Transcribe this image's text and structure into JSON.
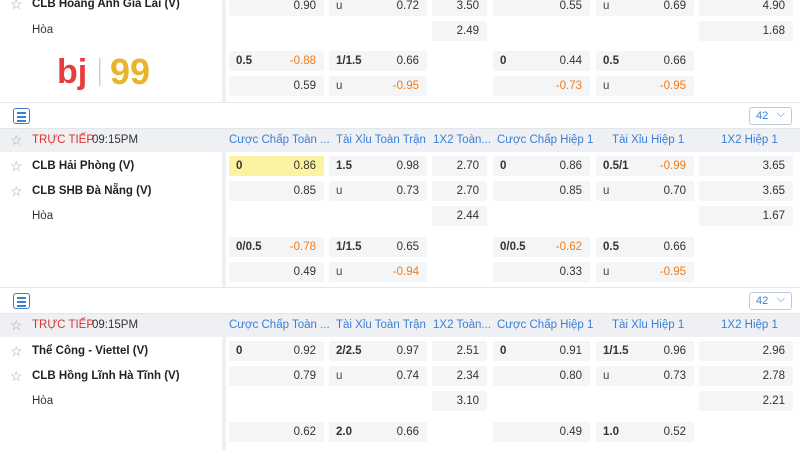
{
  "logo": {
    "part1": "bj",
    "part2": "99"
  },
  "match0": {
    "team1": "CLB Hoàng Anh Gia Lai (V)",
    "draw": "Hòa",
    "row1": [
      [
        "",
        "0.90"
      ],
      [
        "u",
        "0.72"
      ],
      [
        "3.50",
        ""
      ],
      [
        "",
        "0.55"
      ],
      [
        "u",
        "0.69"
      ],
      [
        "4.90",
        ""
      ]
    ],
    "drawrow": [
      "2.49",
      "1.68"
    ],
    "alt1": [
      [
        "0.5",
        "-0.88"
      ],
      [
        "1/1.5",
        "0.66"
      ],
      [
        "0",
        "0.44"
      ],
      [
        "0.5",
        "0.66"
      ]
    ],
    "alt2": [
      [
        "",
        "0.59"
      ],
      [
        "u",
        "-0.95"
      ],
      [
        "",
        "-0.73"
      ],
      [
        "u",
        "-0.95"
      ]
    ]
  },
  "match1": {
    "select": "42",
    "chevron": "⌵",
    "live": "TRỰC TIẾP",
    "time": "09:15PM",
    "cols": [
      "Cược Chấp Toàn ...",
      "Tài Xỉu Toàn Trận",
      "1X2 Toàn...",
      "Cược Chấp Hiệp 1",
      "Tài Xỉu Hiệp 1",
      "1X2 Hiệp 1"
    ],
    "team1": "CLB Hải Phòng (V)",
    "team2": "CLB SHB Đà Nẵng (V)",
    "draw": "Hòa",
    "r1": [
      [
        "0",
        "0.86"
      ],
      [
        "1.5",
        "0.98"
      ],
      [
        "2.70",
        ""
      ],
      [
        "0",
        "0.86"
      ],
      [
        "0.5/1",
        "-0.99"
      ],
      [
        "3.65",
        ""
      ]
    ],
    "r2": [
      [
        "",
        "0.85"
      ],
      [
        "u",
        "0.73"
      ],
      [
        "2.70",
        ""
      ],
      [
        "",
        "0.85"
      ],
      [
        "u",
        "0.70"
      ],
      [
        "3.65",
        ""
      ]
    ],
    "r3": [
      "2.44",
      "1.67"
    ],
    "a1": [
      [
        "0/0.5",
        "-0.78"
      ],
      [
        "1/1.5",
        "0.65"
      ],
      [
        "0/0.5",
        "-0.62"
      ],
      [
        "0.5",
        "0.66"
      ]
    ],
    "a2": [
      [
        "",
        "0.49"
      ],
      [
        "u",
        "-0.94"
      ],
      [
        "",
        "0.33"
      ],
      [
        "u",
        "-0.95"
      ]
    ]
  },
  "match2": {
    "select": "42",
    "chevron": "⌵",
    "live": "TRỰC TIẾP",
    "time": "09:15PM",
    "cols": [
      "Cược Chấp Toàn ...",
      "Tài Xỉu Toàn Trận",
      "1X2 Toàn...",
      "Cược Chấp Hiệp 1",
      "Tài Xỉu Hiệp 1",
      "1X2 Hiệp 1"
    ],
    "team1": "Thể Công - Viettel (V)",
    "team2": "CLB Hồng Lĩnh Hà Tĩnh (V)",
    "draw": "Hòa",
    "r1": [
      [
        "0",
        "0.92"
      ],
      [
        "2/2.5",
        "0.97"
      ],
      [
        "2.51",
        ""
      ],
      [
        "0",
        "0.91"
      ],
      [
        "1/1.5",
        "0.96"
      ],
      [
        "2.96",
        ""
      ]
    ],
    "r2": [
      [
        "",
        "0.79"
      ],
      [
        "u",
        "0.74"
      ],
      [
        "2.34",
        ""
      ],
      [
        "",
        "0.80"
      ],
      [
        "u",
        "0.73"
      ],
      [
        "2.78",
        ""
      ]
    ],
    "r3": [
      "3.10",
      "2.21"
    ],
    "a1": [
      [
        "",
        "0.62"
      ],
      [
        "2.0",
        "0.66"
      ],
      [
        "",
        "0.49"
      ],
      [
        "1.0",
        "0.52"
      ]
    ]
  },
  "colors": {
    "accent": "#3a7fd5",
    "negative": "#f07c1a",
    "live": "#e0322f",
    "highlight": "#fbf3a2"
  }
}
